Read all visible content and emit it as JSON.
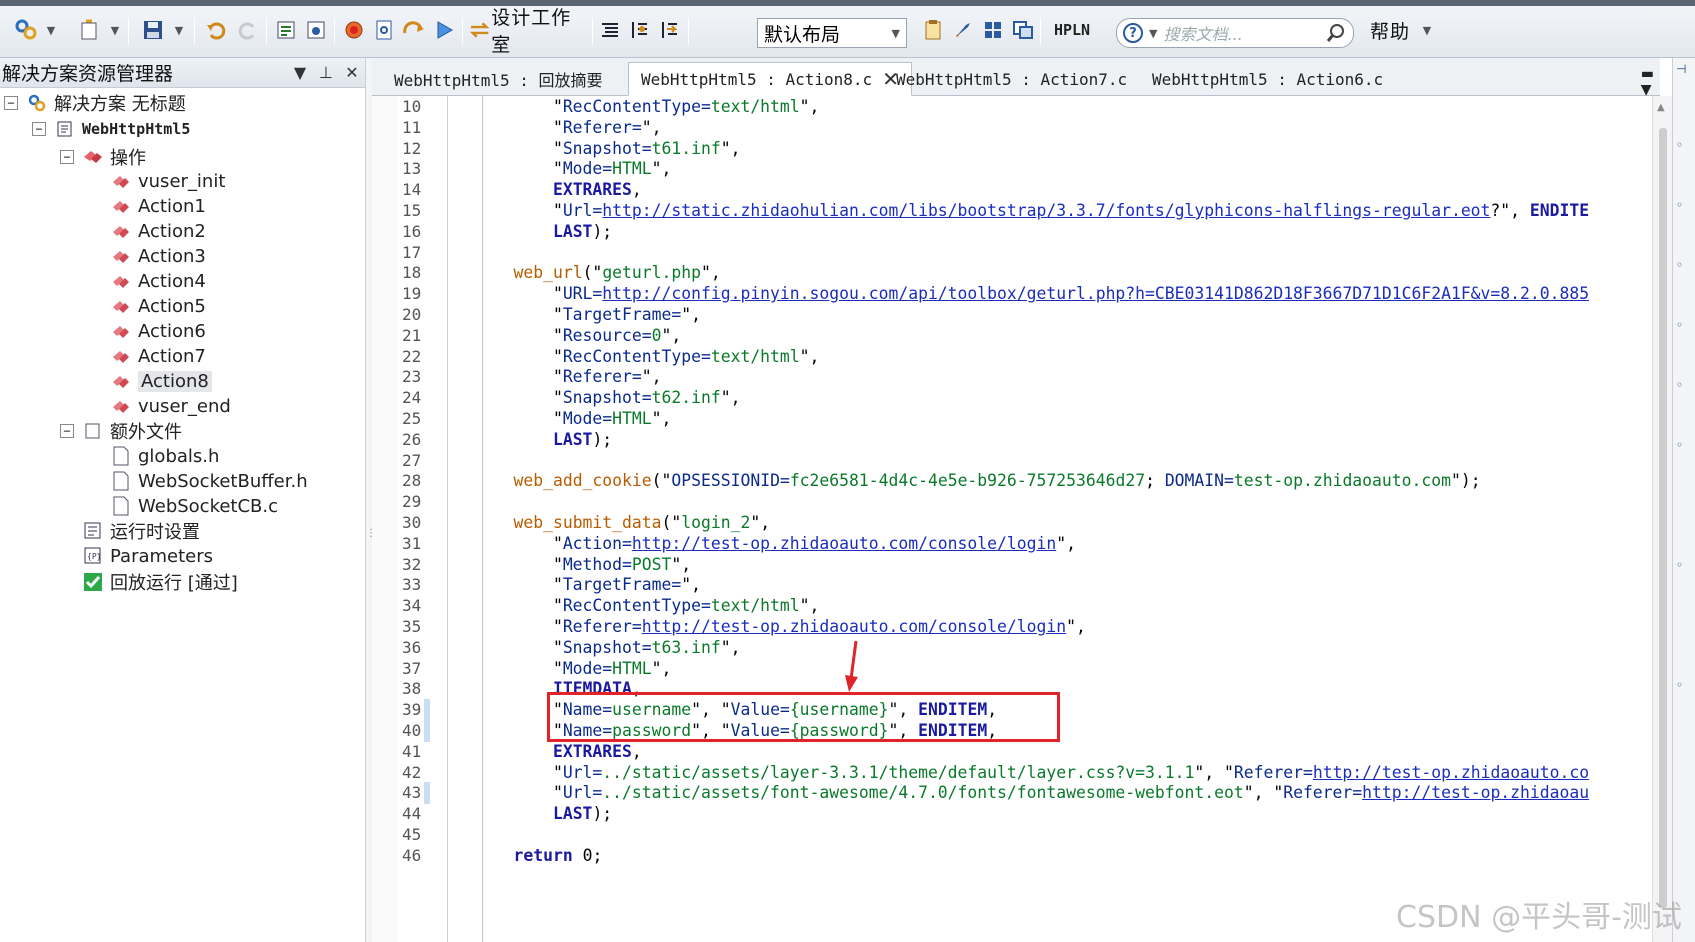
{
  "toolbar": {
    "design_studio_label": "设计工作室",
    "layout_value": "默认布局",
    "hpln_label": "HPLN",
    "search_placeholder": "搜索文档...",
    "help_label": "帮助"
  },
  "explorer": {
    "title": "解决方案资源管理器",
    "solution_label": "解决方案 无标题",
    "script_label": "WebHttpHtml5",
    "actions_group_label": "操作",
    "actions": [
      "vuser_init",
      "Action1",
      "Action2",
      "Action3",
      "Action4",
      "Action5",
      "Action6",
      "Action7",
      "Action8",
      "vuser_end"
    ],
    "selected_action": "Action8",
    "extra_files_label": "额外文件",
    "extra_files": [
      "globals.h",
      "WebSocketBuffer.h",
      "WebSocketCB.c"
    ],
    "runtime_settings_label": "运行时设置",
    "parameters_label": "Parameters",
    "replay_label": "回放运行 [通过]"
  },
  "tabs": [
    {
      "label": "WebHttpHtml5 : 回放摘要",
      "active": false
    },
    {
      "label": "WebHttpHtml5 : Action8.c",
      "active": true
    },
    {
      "label": "WebHttpHtml5 : Action7.c",
      "active": false
    },
    {
      "label": "WebHttpHtml5 : Action6.c",
      "active": false
    }
  ],
  "editor": {
    "line_numbers": [
      "10",
      "11",
      "12",
      "13",
      "14",
      "15",
      "16",
      "17",
      "18",
      "19",
      "20",
      "21",
      "22",
      "23",
      "24",
      "25",
      "26",
      "27",
      "28",
      "29",
      "30",
      "31",
      "32",
      "33",
      "34",
      "35",
      "36",
      "37",
      "38",
      "39",
      "40",
      "41",
      "42",
      "43",
      "44",
      "45",
      "46"
    ],
    "lines": [
      [
        {
          "t": "        \""
        },
        {
          "t": "RecContentType=",
          "c": "s"
        },
        {
          "t": "text/html",
          "c": "v"
        },
        {
          "t": "\","
        }
      ],
      [
        {
          "t": "        \""
        },
        {
          "t": "Referer=",
          "c": "s"
        },
        {
          "t": "\","
        }
      ],
      [
        {
          "t": "        \""
        },
        {
          "t": "Snapshot=",
          "c": "s"
        },
        {
          "t": "t61.inf",
          "c": "v"
        },
        {
          "t": "\","
        }
      ],
      [
        {
          "t": "        \""
        },
        {
          "t": "Mode=",
          "c": "s"
        },
        {
          "t": "HTML",
          "c": "v"
        },
        {
          "t": "\","
        }
      ],
      [
        {
          "t": "        "
        },
        {
          "t": "EXTRARES",
          "c": "k"
        },
        {
          "t": ","
        }
      ],
      [
        {
          "t": "        \""
        },
        {
          "t": "Url=",
          "c": "s"
        },
        {
          "t": "http://static.zhidaohulian.com/libs/bootstrap/3.3.7/fonts/glyphicons-halflings-regular.eot",
          "c": "u"
        },
        {
          "t": "?\", "
        },
        {
          "t": "ENDITE",
          "c": "k"
        }
      ],
      [
        {
          "t": "        "
        },
        {
          "t": "LAST",
          "c": "k"
        },
        {
          "t": ");"
        }
      ],
      [
        {
          "t": ""
        }
      ],
      [
        {
          "t": "    "
        },
        {
          "t": "web_url",
          "c": "fn"
        },
        {
          "t": "(\""
        },
        {
          "t": "geturl.php",
          "c": "v"
        },
        {
          "t": "\","
        }
      ],
      [
        {
          "t": "        \""
        },
        {
          "t": "URL=",
          "c": "s"
        },
        {
          "t": "http://config.pinyin.sogou.com/api/toolbox/geturl.php?h=CBE03141D862D18F3667D71D1C6F2A1F&v=8.2.0.885",
          "c": "u"
        }
      ],
      [
        {
          "t": "        \""
        },
        {
          "t": "TargetFrame=",
          "c": "s"
        },
        {
          "t": "\","
        }
      ],
      [
        {
          "t": "        \""
        },
        {
          "t": "Resource=",
          "c": "s"
        },
        {
          "t": "0",
          "c": "v"
        },
        {
          "t": "\","
        }
      ],
      [
        {
          "t": "        \""
        },
        {
          "t": "RecContentType=",
          "c": "s"
        },
        {
          "t": "text/html",
          "c": "v"
        },
        {
          "t": "\","
        }
      ],
      [
        {
          "t": "        \""
        },
        {
          "t": "Referer=",
          "c": "s"
        },
        {
          "t": "\","
        }
      ],
      [
        {
          "t": "        \""
        },
        {
          "t": "Snapshot=",
          "c": "s"
        },
        {
          "t": "t62.inf",
          "c": "v"
        },
        {
          "t": "\","
        }
      ],
      [
        {
          "t": "        \""
        },
        {
          "t": "Mode=",
          "c": "s"
        },
        {
          "t": "HTML",
          "c": "v"
        },
        {
          "t": "\","
        }
      ],
      [
        {
          "t": "        "
        },
        {
          "t": "LAST",
          "c": "k"
        },
        {
          "t": ");"
        }
      ],
      [
        {
          "t": ""
        }
      ],
      [
        {
          "t": "    "
        },
        {
          "t": "web_add_cookie",
          "c": "fn"
        },
        {
          "t": "(\""
        },
        {
          "t": "OPSESSIONID=",
          "c": "s"
        },
        {
          "t": "fc2e6581-4d4c-4e5e-b926-757253646d27",
          "c": "v"
        },
        {
          "t": "; "
        },
        {
          "t": "DOMAIN=",
          "c": "s"
        },
        {
          "t": "test-op.zhidaoauto.com",
          "c": "v"
        },
        {
          "t": "\");"
        }
      ],
      [
        {
          "t": ""
        }
      ],
      [
        {
          "t": "    "
        },
        {
          "t": "web_submit_data",
          "c": "fn"
        },
        {
          "t": "(\""
        },
        {
          "t": "login_2",
          "c": "v"
        },
        {
          "t": "\","
        }
      ],
      [
        {
          "t": "        \""
        },
        {
          "t": "Action=",
          "c": "s"
        },
        {
          "t": "http://test-op.zhidaoauto.com/console/login",
          "c": "u"
        },
        {
          "t": "\","
        }
      ],
      [
        {
          "t": "        \""
        },
        {
          "t": "Method=",
          "c": "s"
        },
        {
          "t": "POST",
          "c": "v"
        },
        {
          "t": "\","
        }
      ],
      [
        {
          "t": "        \""
        },
        {
          "t": "TargetFrame=",
          "c": "s"
        },
        {
          "t": "\","
        }
      ],
      [
        {
          "t": "        \""
        },
        {
          "t": "RecContentType=",
          "c": "s"
        },
        {
          "t": "text/html",
          "c": "v"
        },
        {
          "t": "\","
        }
      ],
      [
        {
          "t": "        \""
        },
        {
          "t": "Referer=",
          "c": "s"
        },
        {
          "t": "http://test-op.zhidaoauto.com/console/login",
          "c": "u"
        },
        {
          "t": "\","
        }
      ],
      [
        {
          "t": "        \""
        },
        {
          "t": "Snapshot=",
          "c": "s"
        },
        {
          "t": "t63.inf",
          "c": "v"
        },
        {
          "t": "\","
        }
      ],
      [
        {
          "t": "        \""
        },
        {
          "t": "Mode=",
          "c": "s"
        },
        {
          "t": "HTML",
          "c": "v"
        },
        {
          "t": "\","
        }
      ],
      [
        {
          "t": "        "
        },
        {
          "t": "ITEMDATA",
          "c": "k"
        },
        {
          "t": ","
        }
      ],
      [
        {
          "t": "        \""
        },
        {
          "t": "Name=",
          "c": "s"
        },
        {
          "t": "username",
          "c": "v"
        },
        {
          "t": "\", \""
        },
        {
          "t": "Value=",
          "c": "s"
        },
        {
          "t": "{username}",
          "c": "v"
        },
        {
          "t": "\", "
        },
        {
          "t": "ENDITEM",
          "c": "k"
        },
        {
          "t": ","
        }
      ],
      [
        {
          "t": "        \""
        },
        {
          "t": "Name=",
          "c": "s"
        },
        {
          "t": "password",
          "c": "v"
        },
        {
          "t": "\", \""
        },
        {
          "t": "Value=",
          "c": "s"
        },
        {
          "t": "{password}",
          "c": "v"
        },
        {
          "t": "\", "
        },
        {
          "t": "ENDITEM",
          "c": "k"
        },
        {
          "t": ","
        }
      ],
      [
        {
          "t": "        "
        },
        {
          "t": "EXTRARES",
          "c": "k"
        },
        {
          "t": ","
        }
      ],
      [
        {
          "t": "        \""
        },
        {
          "t": "Url=",
          "c": "s"
        },
        {
          "t": "../static/assets/layer-3.3.1/theme/default/layer.css?v=3.1.1",
          "c": "v"
        },
        {
          "t": "\", \""
        },
        {
          "t": "Referer=",
          "c": "s"
        },
        {
          "t": "http://test-op.zhidaoauto.co",
          "c": "u"
        }
      ],
      [
        {
          "t": "        \""
        },
        {
          "t": "Url=",
          "c": "s"
        },
        {
          "t": "../static/assets/font-awesome/4.7.0/fonts/fontawesome-webfont.eot",
          "c": "v"
        },
        {
          "t": "\", \""
        },
        {
          "t": "Referer=",
          "c": "s"
        },
        {
          "t": "http://test-op.zhidaoau",
          "c": "u"
        }
      ],
      [
        {
          "t": "        "
        },
        {
          "t": "LAST",
          "c": "k"
        },
        {
          "t": ");"
        }
      ],
      [
        {
          "t": ""
        }
      ],
      [
        {
          "t": "    "
        },
        {
          "t": "return",
          "c": "k"
        },
        {
          "t": " 0;"
        }
      ]
    ]
  },
  "watermark": "CSDN @平头哥-测试"
}
